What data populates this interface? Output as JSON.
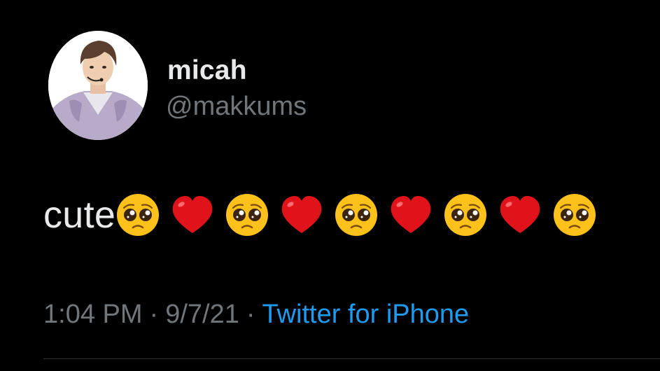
{
  "colors": {
    "background": "#000000",
    "text_primary": "#e7e9ea",
    "text_secondary": "#71767b",
    "link": "#1d9bf0",
    "divider": "#2f3336"
  },
  "author": {
    "display_name": "micah",
    "handle": "@makkums",
    "avatar_icon": "profile-photo"
  },
  "tweet": {
    "text": "cute",
    "emojis": [
      "pleading-face",
      "red-heart",
      "pleading-face",
      "red-heart",
      "pleading-face",
      "red-heart",
      "pleading-face",
      "red-heart",
      "pleading-face"
    ]
  },
  "meta": {
    "time": "1:04 PM",
    "separator": "·",
    "date": "9/7/21",
    "source": "Twitter for iPhone"
  }
}
